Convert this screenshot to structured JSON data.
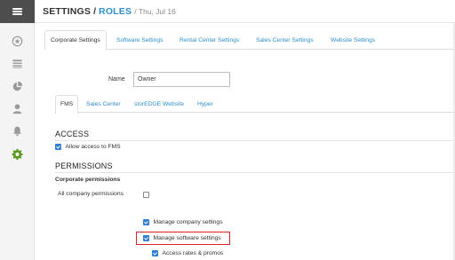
{
  "sidebar": {
    "icons": [
      "menu-icon",
      "dashboard-icon",
      "list-icon",
      "pie-chart-icon",
      "user-icon",
      "bell-icon",
      "gear-icon"
    ],
    "accent_color": "#5a9a1e"
  },
  "header": {
    "crumb_root": "SETTINGS",
    "separator": "/",
    "crumb_current": "ROLES",
    "date": "/ Thu, Jul 16"
  },
  "main_tabs": [
    {
      "label": "Corporate Settings",
      "active": true
    },
    {
      "label": "Software Settings",
      "active": false
    },
    {
      "label": "Rental Center Settings",
      "active": false
    },
    {
      "label": "Sales Center Settings",
      "active": false
    },
    {
      "label": "Website Settings",
      "active": false
    }
  ],
  "name_field": {
    "label": "Name",
    "value": "Owner"
  },
  "sub_tabs": [
    {
      "label": "FMS",
      "active": true
    },
    {
      "label": "Sales Center",
      "active": false
    },
    {
      "label": "storEDGE Website",
      "active": false
    },
    {
      "label": "Hyper",
      "active": false
    }
  ],
  "access": {
    "title": "ACCESS",
    "allow_label": "Allow access to FMS",
    "allow_checked": true
  },
  "permissions": {
    "title": "PERMISSIONS",
    "corporate_heading": "Corporate permissions",
    "all_company_label": "All company permissions",
    "all_company_checked": false,
    "items": [
      {
        "label": "Manage company settings",
        "checked": true
      },
      {
        "label": "Manage software settings",
        "checked": true,
        "highlighted": true
      },
      {
        "label": "Access rates & promos",
        "checked": true
      }
    ]
  },
  "colors": {
    "link": "#2f8fd0",
    "checkbox": "#2f7fd2",
    "highlight": "#d9222a",
    "topbar": "#4d4d4d"
  }
}
